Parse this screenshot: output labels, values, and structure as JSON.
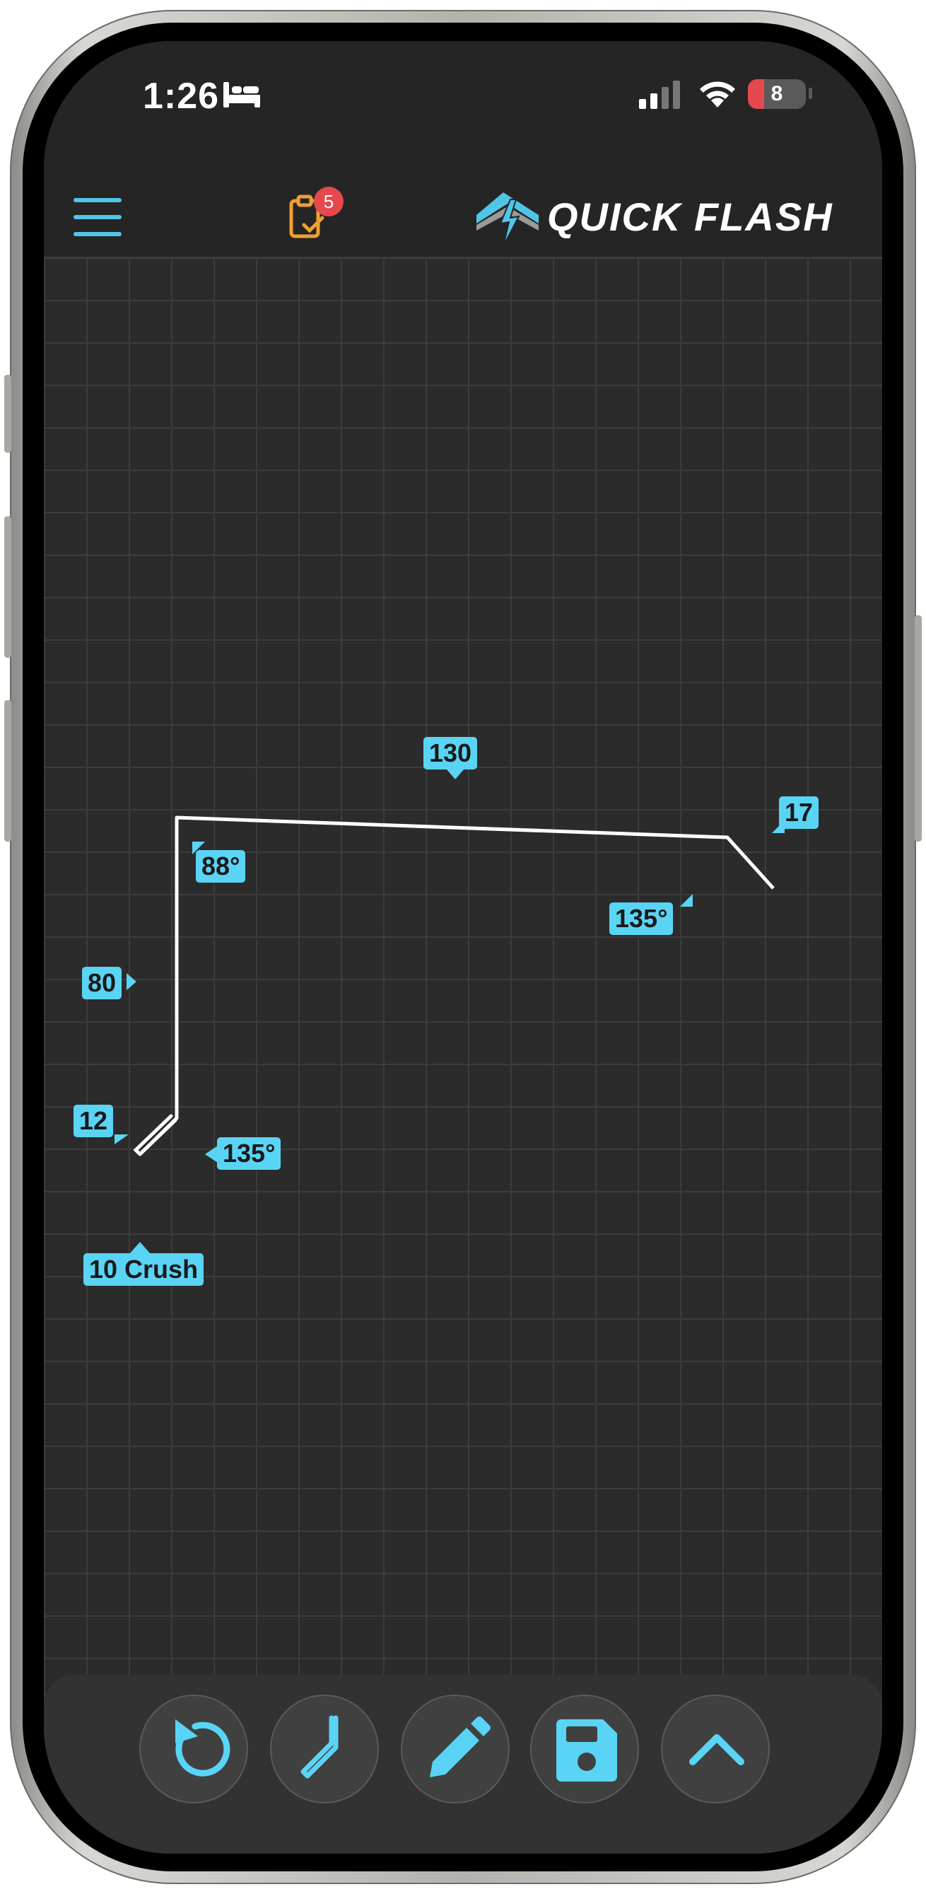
{
  "status_bar": {
    "time": "1:26",
    "battery_level": "8",
    "battery_fraction": 0.08,
    "icons": [
      "bed-icon",
      "cellular-signal-icon",
      "wifi-icon",
      "battery-icon"
    ]
  },
  "header": {
    "menu_icon": "hamburger-menu-icon",
    "tasks_icon": "clipboard-check-icon",
    "tasks_badge": "5",
    "logo_text": "QUICK FLASH",
    "colors": {
      "accent": "#4fc6e8",
      "badge": "#e5484d",
      "tasks_icon": "#f0a030"
    }
  },
  "canvas": {
    "colors": {
      "background": "#2b2b2b",
      "grid": "#3c3c3c",
      "line": "#ffffff",
      "label_bg": "#5ad4f5"
    },
    "labels": {
      "top_segment": "130",
      "right_segment": "17",
      "top_left_angle": "88°",
      "top_right_angle": "135°",
      "left_segment": "80",
      "hem_segment": "12",
      "bottom_angle": "135°",
      "crush": "10 Crush"
    }
  },
  "toolbar": {
    "buttons": [
      {
        "name": "undo-button",
        "icon": "undo-icon"
      },
      {
        "name": "bend-tool-button",
        "icon": "bend-line-icon"
      },
      {
        "name": "edit-button",
        "icon": "pencil-icon"
      },
      {
        "name": "save-button",
        "icon": "floppy-disk-icon"
      },
      {
        "name": "expand-button",
        "icon": "chevron-up-icon"
      }
    ]
  }
}
